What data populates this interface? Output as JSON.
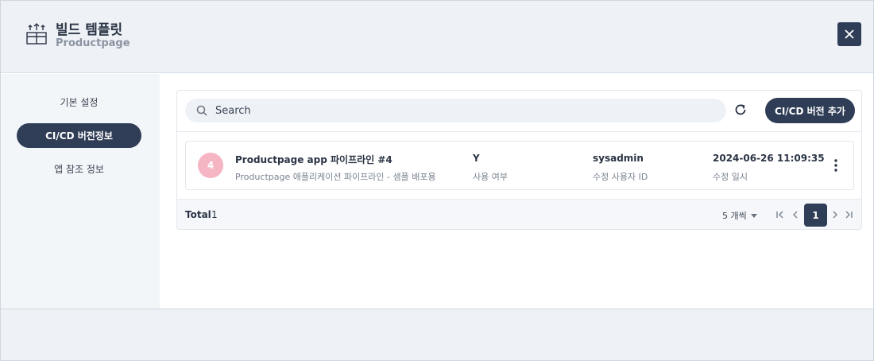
{
  "header": {
    "title": "빌드 템플릿",
    "subtitle": "Productpage",
    "logo_icon": "box-upload-icon",
    "close_icon": "close-icon"
  },
  "sidebar": {
    "items": [
      {
        "label": "기본 설정",
        "active": false
      },
      {
        "label": "CI/CD 버전정보",
        "active": true
      },
      {
        "label": "앱 참조 정보",
        "active": false
      }
    ]
  },
  "toolbar": {
    "search_placeholder": "Search",
    "add_label": "CI/CD 버전 추가"
  },
  "rows": [
    {
      "badge": "4",
      "name": "Productpage app 파이프라인 #4",
      "description": "Productpage 애플리케이션 파이프라인 - 샘플 배포용",
      "used": "Y",
      "used_label": "사용 여부",
      "modifier": "sysadmin",
      "modifier_label": "수정 사용자 ID",
      "modified_at": "2024-06-26 11:09:35",
      "modified_label": "수정 일시"
    }
  ],
  "footer": {
    "total_label": "Total",
    "total_value": "1",
    "page_size": "5 개씩",
    "current_page": "1"
  },
  "colors": {
    "primary": "#2f3d56",
    "badge": "#f5b5c3",
    "header_bg": "#eef2f7"
  }
}
